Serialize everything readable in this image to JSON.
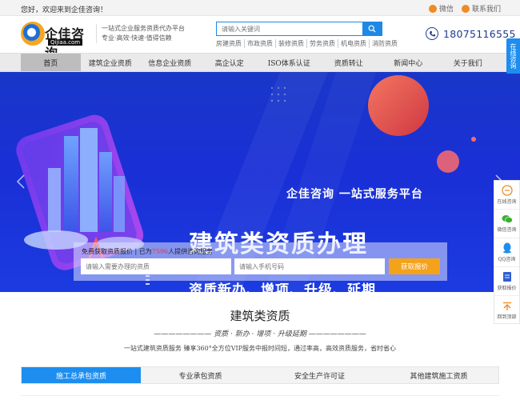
{
  "topbar": {
    "welcome": "您好，欢迎来到企佳咨询！",
    "wechat": "微信",
    "contact": "联系我们"
  },
  "header": {
    "logo_text": "企佳咨询",
    "logo_sub": "Qijiaa.com",
    "slogan_line1": "一站式企业服务资质代办平台",
    "slogan_line2": "专业·高效·快速·值得信赖",
    "search_placeholder": "请输入关键词",
    "hotwords": [
      "房建资质",
      "市政资质",
      "装修资质",
      "劳务资质",
      "机电资质",
      "消防资质"
    ],
    "phone": "18075116555"
  },
  "nav": {
    "items": [
      "首页",
      "建筑企业资质",
      "信息企业资质",
      "高企认定",
      "ISO体系认证",
      "资质转让",
      "新闻中心",
      "关于我们"
    ]
  },
  "banner": {
    "tagline": "企佳咨询  一站式服务平台",
    "headline": "建筑类资质办理",
    "subline": "资质新办、增项、升级、延期"
  },
  "inquiry": {
    "msg_prefix": "免费获取资质报价 | 已为",
    "count": "7596",
    "msg_suffix": "人提供咨询服务",
    "placeholder_need": "请输入需要办理的资质",
    "placeholder_phone": "请输入手机号码",
    "button": "获取报价"
  },
  "section": {
    "title": "建筑类资质",
    "subtitle": "———————— 资质 · 新办 · 增项 · 升级延期 ————————",
    "description": "一站式建筑资质服务 臻享360°全方位VIP服务中报时间短，通过率高，高效资质服务，省时省心",
    "tabs": [
      "施工总承包资质",
      "专业承包资质",
      "安全生产许可证",
      "其他建筑施工资质"
    ]
  },
  "side": {
    "online_tab": "在线咨询",
    "items": [
      "在线咨询",
      "微信咨询",
      "QQ咨询",
      "获取报价",
      "回到顶部"
    ]
  },
  "colors": {
    "primary_blue": "#1d8ef0",
    "banner_blue": "#1a2fd6",
    "orange": "#f5a21b",
    "phone_navy": "#1f3b8f"
  }
}
